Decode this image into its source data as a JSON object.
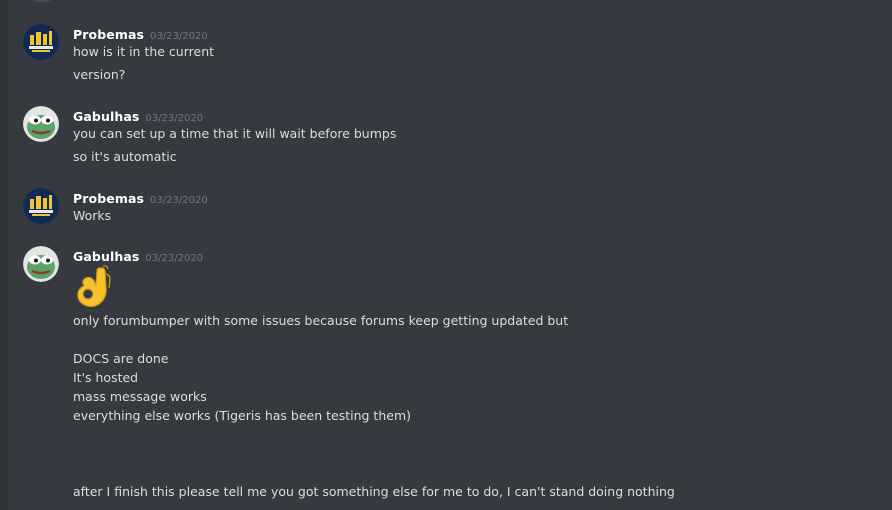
{
  "top_partial_text": "· · · · ·  · · · ·",
  "messages": [
    {
      "author": "Probemas",
      "timestamp": "03/23/2020",
      "avatar": "probemas-logo",
      "lines": [
        "how is it in the current",
        "version?"
      ]
    },
    {
      "author": "Gabulhas",
      "timestamp": "03/23/2020",
      "avatar": "pepe-frog",
      "lines": [
        "you can set up a time that it will wait before bumps",
        "so it's automatic"
      ]
    },
    {
      "author": "Probemas",
      "timestamp": "03/23/2020",
      "avatar": "probemas-logo",
      "lines": [
        "Works"
      ]
    },
    {
      "author": "Gabulhas",
      "timestamp": "03/23/2020",
      "avatar": "pepe-frog",
      "emoji": "ok-hand-emoji",
      "lines": [
        "only forumbumper with some issues because forums keep getting updated but",
        "DOCS are done",
        "It's hosted",
        "mass message works",
        "everything else works (Tigeris has been testing them)",
        "after I finish this please tell me you got something else for me to do, I can't stand doing nothing"
      ]
    }
  ],
  "colors": {
    "background": "#36393f",
    "username": "#ffffff",
    "text": "#dcddde",
    "timestamp": "#72767d",
    "emoji": "#f7c22e"
  }
}
